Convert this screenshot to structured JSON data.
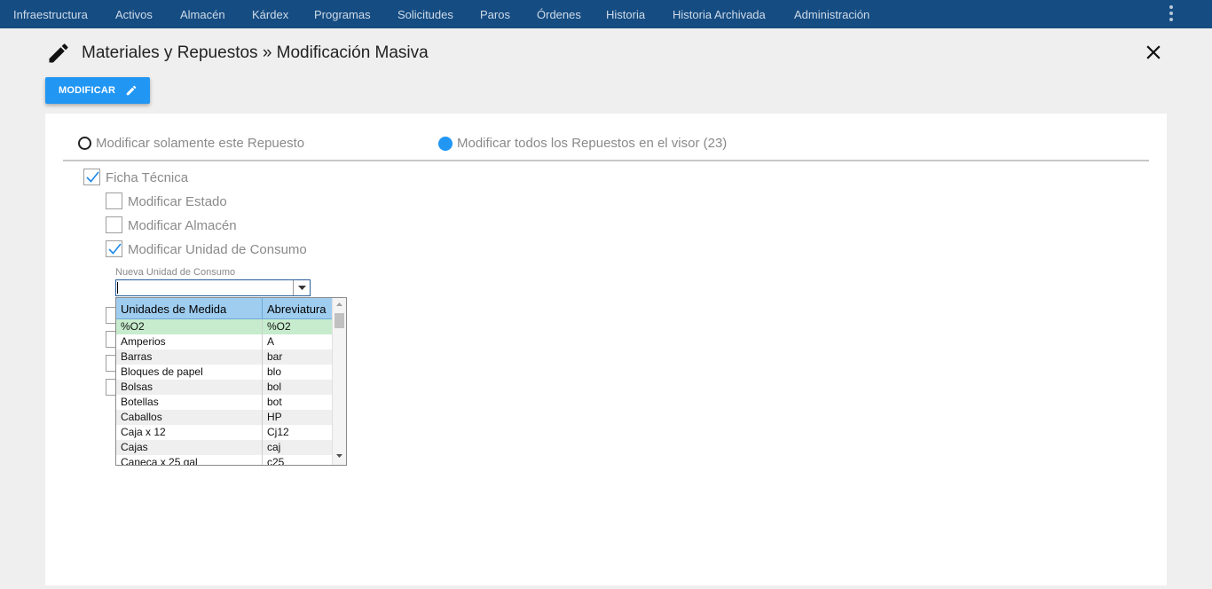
{
  "nav": {
    "items": [
      "Infraestructura",
      "Activos",
      "Almacén",
      "Kárdex",
      "Programas",
      "Solicitudes",
      "Paros",
      "Órdenes",
      "Historia",
      "Historia Archivada",
      "Administración"
    ],
    "more_icon": "vertical-dots-icon"
  },
  "header": {
    "title": "Materiales y Repuestos » Modificación Masiva",
    "title_icon": "pencil-icon",
    "close_icon": "close-icon"
  },
  "toolbar": {
    "modify_label": "MODIFICAR",
    "modify_icon": "pencil-icon"
  },
  "scope": {
    "option_single": "Modificar solamente este Repuesto",
    "option_all": "Modificar todos los Repuestos en el visor (23)",
    "selected": "all"
  },
  "checks": {
    "ficha_tecnica": {
      "label": "Ficha Técnica",
      "checked": true
    },
    "estado": {
      "label": "Modificar Estado",
      "checked": false
    },
    "almacen": {
      "label": "Modificar Almacén",
      "checked": false
    },
    "unidad": {
      "label": "Modificar Unidad de Consumo",
      "checked": true
    }
  },
  "unit_field": {
    "label": "Nueva Unidad de Consumo",
    "value": ""
  },
  "dropdown": {
    "col1": "Unidades de Medida",
    "col2": "Abreviatura",
    "rows": [
      {
        "name": "%O2",
        "abbr": "%O2"
      },
      {
        "name": "Amperios",
        "abbr": "A"
      },
      {
        "name": "Barras",
        "abbr": "bar"
      },
      {
        "name": "Bloques de papel",
        "abbr": "blo"
      },
      {
        "name": "Bolsas",
        "abbr": "bol"
      },
      {
        "name": "Botellas",
        "abbr": "bot"
      },
      {
        "name": "Caballos",
        "abbr": "HP"
      },
      {
        "name": "Caja x 12",
        "abbr": "Cj12"
      },
      {
        "name": "Cajas",
        "abbr": "caj"
      },
      {
        "name": "Caneca x 25 gal",
        "abbr": "c25"
      }
    ]
  },
  "colors": {
    "nav_bg": "#154c82",
    "accent": "#2196f3",
    "selected_row": "#c6eccd",
    "header_row": "#9fcdf0"
  }
}
